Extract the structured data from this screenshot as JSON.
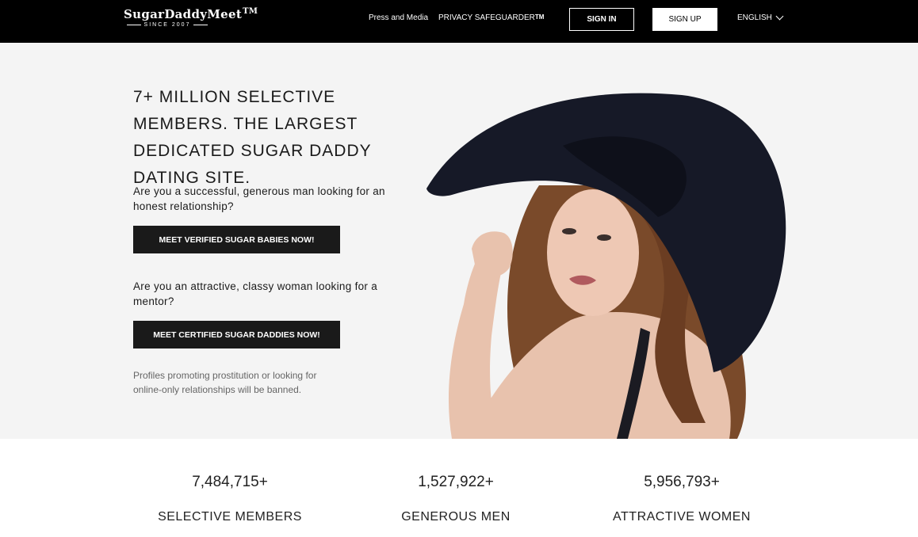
{
  "header": {
    "logo_text": "SugarDaddyMeet",
    "logo_tm": "TM",
    "logo_since": "SINCE 2007",
    "nav_press": "Press and Media",
    "nav_privacy": "PRIVACY SAFEGUARDER",
    "nav_privacy_tm": "TM",
    "signin_label": "SIGN IN",
    "signup_label": "SIGN UP",
    "language": "ENGLISH"
  },
  "hero": {
    "headline": "7+ MILLION SELECTIVE MEMBERS. THE LARGEST DEDICATED SUGAR DADDY DATING SITE.",
    "question_men": "Are you a successful, generous man looking for an honest relationship?",
    "cta_men": "MEET VERIFIED SUGAR BABIES NOW!",
    "question_women": "Are you an attractive, classy woman looking for a mentor?",
    "cta_women": "MEET CERTIFIED SUGAR DADDIES NOW!",
    "disclaimer": "Profiles promoting prostitution or looking for online-only relationships will be banned."
  },
  "stats": [
    {
      "value": "7,484,715+",
      "label": "SELECTIVE MEMBERS"
    },
    {
      "value": "1,527,922+",
      "label": "GENEROUS MEN"
    },
    {
      "value": "5,956,793+",
      "label": "ATTRACTIVE WOMEN"
    }
  ],
  "colors": {
    "header_bg": "#000000",
    "hero_bg": "#f4f4f4",
    "cta_bg": "#1a1a1a",
    "hat": "#161927",
    "hair": "#7a4a2a",
    "skin": "#e8c2ad"
  }
}
